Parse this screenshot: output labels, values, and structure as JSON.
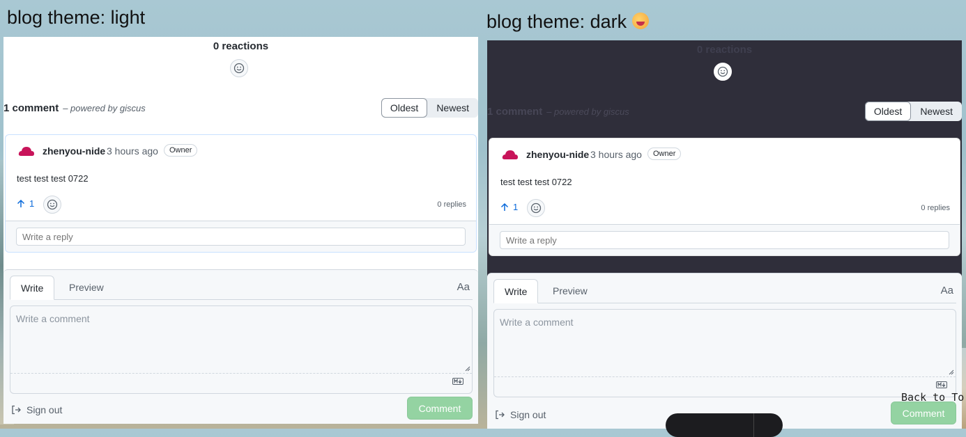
{
  "light_section": {
    "title": "blog theme: light",
    "reactions": "0 reactions",
    "comment_count": "1 comment",
    "powered_by": "– powered by giscus",
    "sort": {
      "oldest": "Oldest",
      "newest": "Newest"
    },
    "comment": {
      "author": "zhenyou-nide",
      "time": "3 hours ago",
      "badge": "Owner",
      "body": "test test test 0722",
      "upvotes": "1",
      "replies": "0 replies",
      "reply_placeholder": "Write a reply"
    },
    "editor": {
      "write_tab": "Write",
      "preview_tab": "Preview",
      "format_label": "Aa",
      "comment_placeholder": "Write a comment",
      "sign_out": "Sign out",
      "comment_button": "Comment"
    }
  },
  "dark_section": {
    "title": "blog theme: dark",
    "reactions": "0 reactions",
    "comment_count": "1 comment",
    "powered_by": "– powered by giscus",
    "sort": {
      "oldest": "Oldest",
      "newest": "Newest"
    },
    "comment": {
      "author": "zhenyou-nide",
      "time": "3 hours ago",
      "badge": "Owner",
      "body": "test test test 0722",
      "upvotes": "1",
      "replies": "0 replies",
      "reply_placeholder": "Write a reply"
    },
    "editor": {
      "write_tab": "Write",
      "preview_tab": "Preview",
      "format_label": "Aa",
      "comment_placeholder": "Write a comment",
      "sign_out": "Sign out",
      "comment_button": "Comment"
    }
  },
  "back_to_top": "Back to To",
  "colors": {
    "accent": "#0969da",
    "avatar": "#c8145a",
    "comment_button": "#94d3a2",
    "dark_bg": "#2f2e3a"
  },
  "icons": [
    "smile-icon",
    "arrow-up-icon",
    "markdown-icon",
    "sign-out-icon",
    "resize-handle-icon",
    "grinning-emoji-icon",
    "avatar-icon"
  ]
}
